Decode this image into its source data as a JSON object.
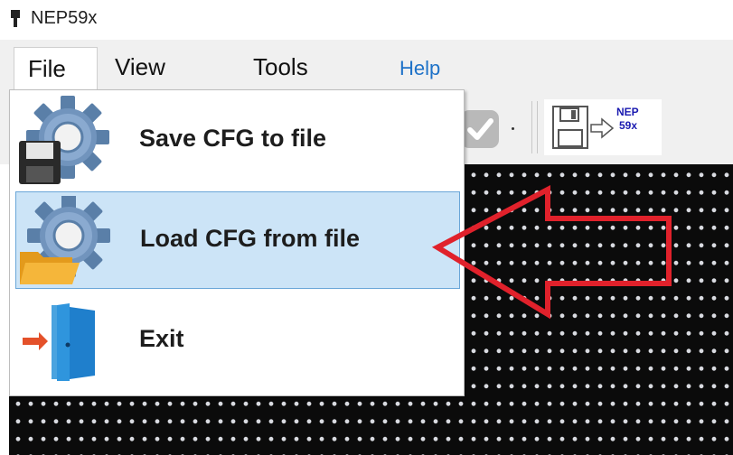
{
  "window": {
    "title": "NEP59x"
  },
  "menubar": {
    "file": "File",
    "view": "View",
    "tools": "Tools",
    "help": "Help"
  },
  "toolbar": {
    "send_button": {
      "line1": "NEP",
      "line2": "59x"
    }
  },
  "file_menu": {
    "items": [
      {
        "label": "Save CFG to file",
        "icon": "save-config-icon"
      },
      {
        "label": "Load CFG from file",
        "icon": "load-config-icon",
        "highlighted": true
      },
      {
        "label": "Exit",
        "icon": "exit-door-icon"
      }
    ]
  },
  "colors": {
    "accent_blue": "#1e72c8",
    "highlight_bg": "#cce4f7",
    "highlight_border": "#6aa6d8",
    "annotation_arrow": "#e0212b",
    "panel_bg": "#0b0b0b"
  }
}
